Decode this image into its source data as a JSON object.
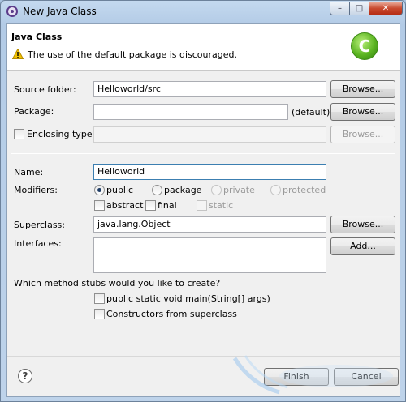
{
  "window": {
    "title": "New Java Class",
    "minimize_glyph": "–",
    "maximize_glyph": "□",
    "close_glyph": "✕"
  },
  "header": {
    "title": "Java Class",
    "message": "The use of the default package is discouraged.",
    "badge_letter": "C",
    "badge_color": "#5cb522",
    "warning_color": "#f2c200"
  },
  "form": {
    "source_folder": {
      "label": "Source folder:",
      "value": "Helloworld/src",
      "button": "Browse..."
    },
    "package": {
      "label": "Package:",
      "value": "",
      "suffix": "(default)",
      "button": "Browse..."
    },
    "enclosing_type": {
      "label": "Enclosing type:",
      "value": "",
      "button": "Browse...",
      "checked": false
    },
    "name": {
      "label": "Name:",
      "value": "Helloworld"
    },
    "modifiers": {
      "label": "Modifiers:",
      "access": [
        "public",
        "package",
        "private",
        "protected"
      ],
      "selected": "public",
      "flags": [
        "abstract",
        "final",
        "static"
      ]
    },
    "superclass": {
      "label": "Superclass:",
      "value": "java.lang.Object",
      "button": "Browse..."
    },
    "interfaces": {
      "label": "Interfaces:",
      "button": "Add..."
    },
    "stubs": {
      "question": "Which method stubs would you like to create?",
      "options": [
        "public static void main(String[] args)",
        "Constructors from superclass"
      ]
    }
  },
  "footer": {
    "help_glyph": "?",
    "finish": "Finish",
    "cancel": "Cancel"
  }
}
